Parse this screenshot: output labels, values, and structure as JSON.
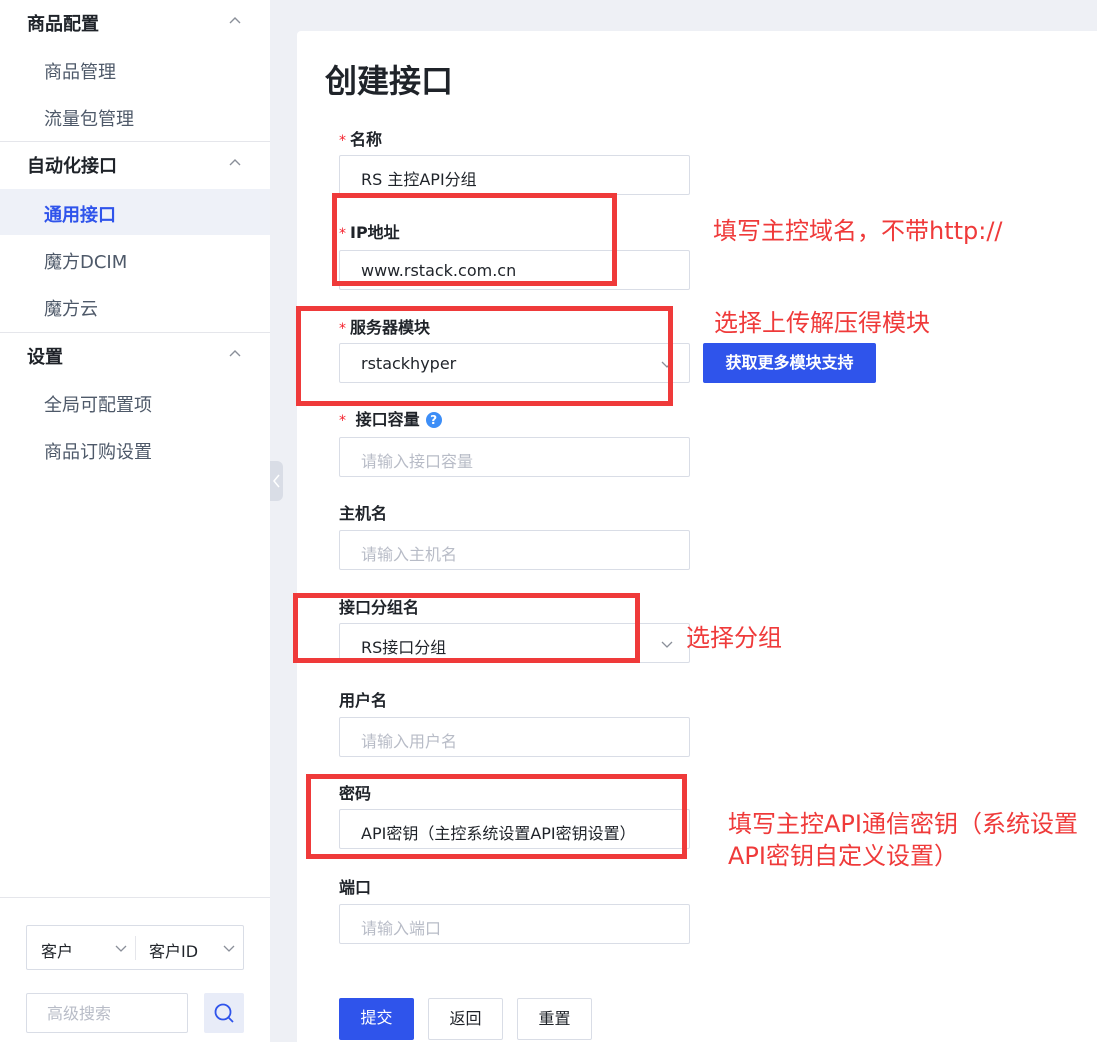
{
  "sidebar": {
    "sections": [
      {
        "title": "商品配置",
        "items": [
          "商品管理",
          "流量包管理"
        ]
      },
      {
        "title": "自动化接口",
        "items": [
          "通用接口",
          "魔方DCIM",
          "魔方云"
        ]
      },
      {
        "title": "设置",
        "items": [
          "全局可配置项",
          "商品订购设置"
        ]
      }
    ],
    "active_item": "通用接口",
    "search": {
      "type_select": "客户",
      "field_select": "客户ID",
      "advanced_placeholder": "高级搜索"
    }
  },
  "page": {
    "title": "创建接口"
  },
  "form": {
    "name": {
      "label": "名称",
      "value": "RS 主控API分组"
    },
    "ip": {
      "label": "IP地址",
      "value": "www.rstack.com.cn"
    },
    "module": {
      "label": "服务器模块",
      "value": "rstackhyper",
      "more_button": "获取更多模块支持"
    },
    "capacity": {
      "label": "接口容量",
      "placeholder": "请输入接口容量",
      "help": "?"
    },
    "hostname": {
      "label": "主机名",
      "placeholder": "请输入主机名"
    },
    "group": {
      "label": "接口分组名",
      "value": "RS接口分组"
    },
    "username": {
      "label": "用户名",
      "placeholder": "请输入用户名"
    },
    "password": {
      "label": "密码",
      "value": "API密钥（主控系统设置API密钥设置）"
    },
    "port": {
      "label": "端口",
      "placeholder": "请输入端口"
    },
    "required_mark": "*"
  },
  "actions": {
    "submit": "提交",
    "back": "返回",
    "reset": "重置"
  },
  "annotations": {
    "ip_note": "填写主控域名，不带http://",
    "module_note": "选择上传解压得模块",
    "group_note": "选择分组",
    "password_note_line1": "填写主控API通信密钥（系统设置",
    "password_note_line2": "API密钥自定义设置）"
  },
  "colors": {
    "primary": "#2f54eb",
    "annotation": "#ef3a3a",
    "required": "#f5222d"
  }
}
